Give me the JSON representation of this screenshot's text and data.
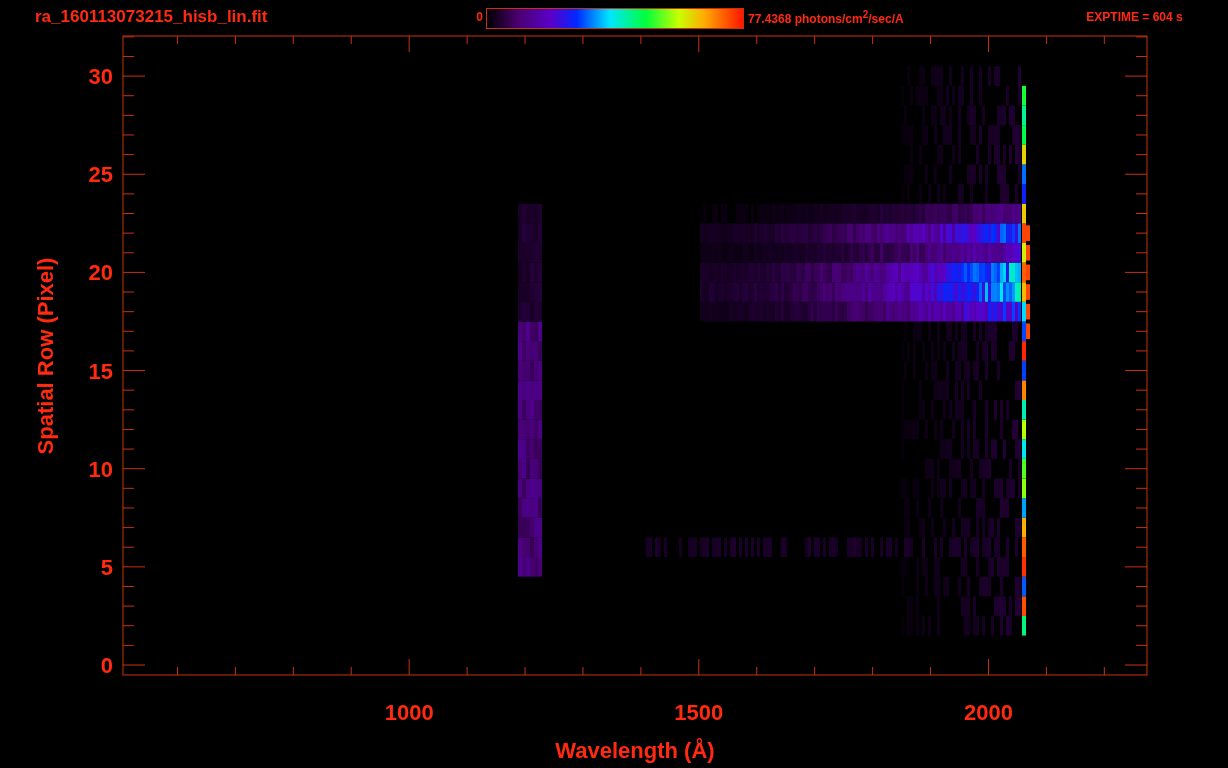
{
  "header": {
    "title": "ra_160113073215_hisb_lin.fit",
    "colorbar_min": "0",
    "colorbar_max": "77.4368 photons/cm$^{2}$/sec/A",
    "exposure": "EXPTIME = 604 s"
  },
  "y_axis": {
    "label": "Spatial Row (Pixel)",
    "ticks": [
      "30",
      "25",
      "20",
      "15",
      "10",
      "5",
      "0"
    ]
  },
  "x_axis": {
    "label": "Wavelength (Å)",
    "ticks": [
      "1000",
      "1500",
      "2000"
    ]
  }
}
